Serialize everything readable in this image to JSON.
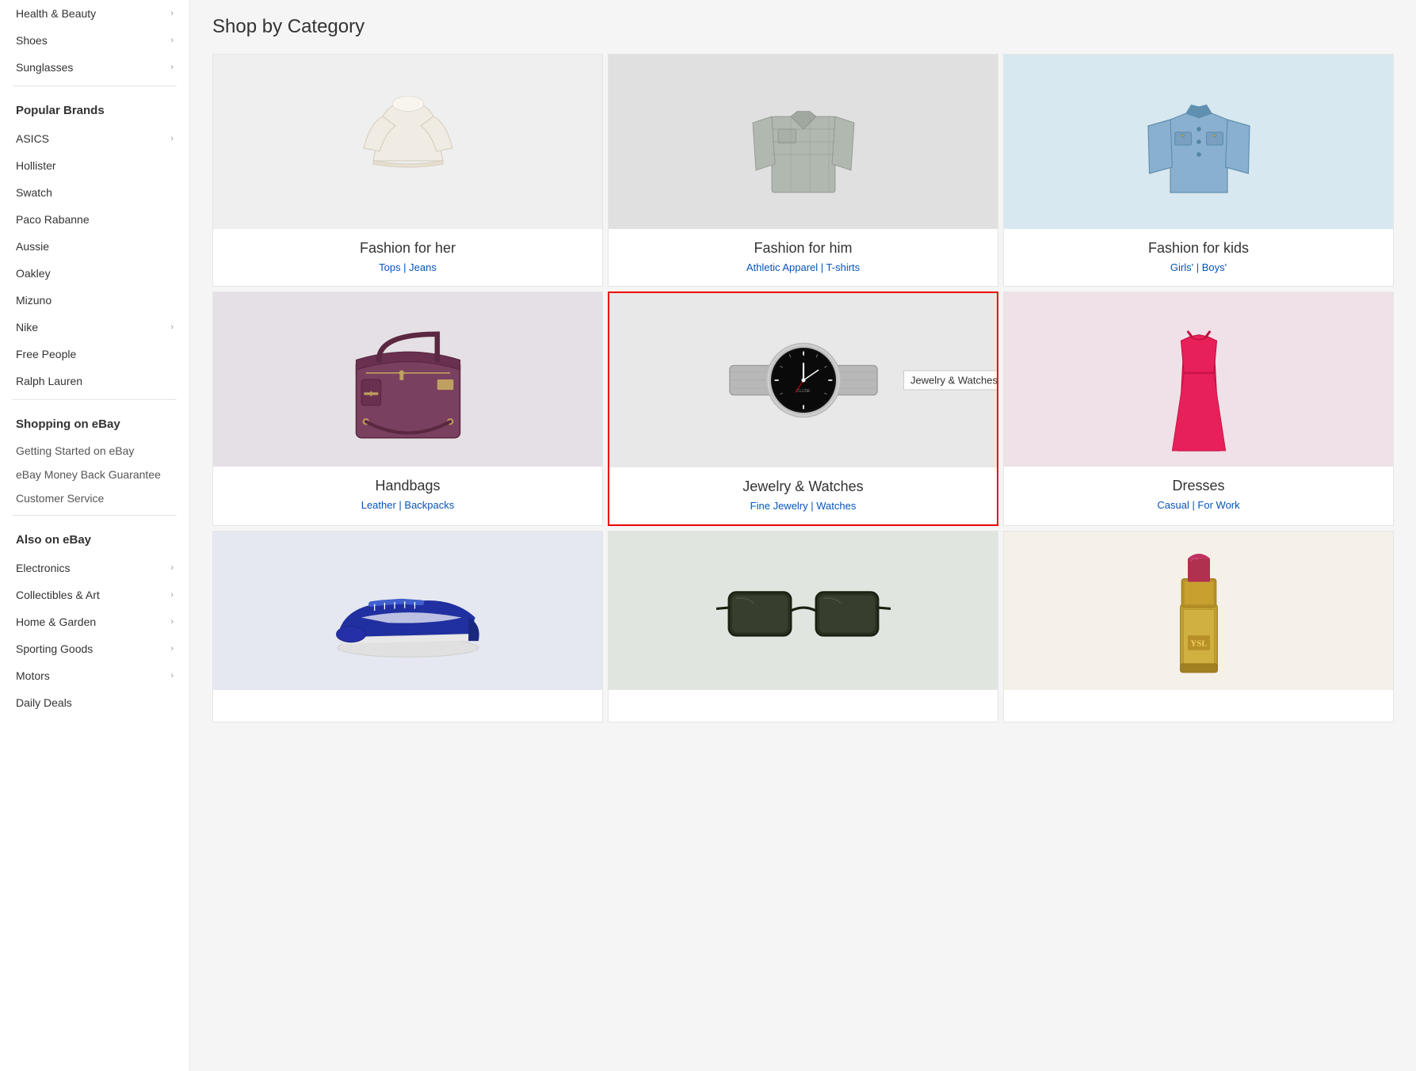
{
  "sidebar": {
    "top_items": [
      {
        "label": "Health & Beauty",
        "has_chevron": true,
        "name": "health-beauty"
      },
      {
        "label": "Shoes",
        "has_chevron": true,
        "name": "shoes"
      },
      {
        "label": "Sunglasses",
        "has_chevron": true,
        "name": "sunglasses"
      }
    ],
    "popular_brands_title": "Popular Brands",
    "brands": [
      {
        "label": "ASICS",
        "has_chevron": true,
        "name": "asics"
      },
      {
        "label": "Hollister",
        "has_chevron": false,
        "name": "hollister"
      },
      {
        "label": "Swatch",
        "has_chevron": false,
        "name": "swatch"
      },
      {
        "label": "Paco Rabanne",
        "has_chevron": false,
        "name": "paco-rabanne"
      },
      {
        "label": "Aussie",
        "has_chevron": false,
        "name": "aussie"
      },
      {
        "label": "Oakley",
        "has_chevron": false,
        "name": "oakley"
      },
      {
        "label": "Mizuno",
        "has_chevron": false,
        "name": "mizuno"
      },
      {
        "label": "Nike",
        "has_chevron": true,
        "name": "nike"
      },
      {
        "label": "Free People",
        "has_chevron": false,
        "name": "free-people"
      },
      {
        "label": "Ralph Lauren",
        "has_chevron": false,
        "name": "ralph-lauren"
      }
    ],
    "shopping_title": "Shopping on eBay",
    "shopping_links": [
      {
        "label": "Getting Started on eBay",
        "name": "getting-started"
      },
      {
        "label": "eBay Money Back Guarantee",
        "name": "money-back"
      },
      {
        "label": "Customer Service",
        "name": "customer-service"
      }
    ],
    "also_title": "Also on eBay",
    "also_items": [
      {
        "label": "Electronics",
        "has_chevron": true,
        "name": "electronics"
      },
      {
        "label": "Collectibles & Art",
        "has_chevron": true,
        "name": "collectibles"
      },
      {
        "label": "Home & Garden",
        "has_chevron": true,
        "name": "home-garden"
      },
      {
        "label": "Sporting Goods",
        "has_chevron": true,
        "name": "sporting-goods"
      },
      {
        "label": "Motors",
        "has_chevron": true,
        "name": "motors"
      },
      {
        "label": "Daily Deals",
        "has_chevron": false,
        "name": "daily-deals"
      }
    ]
  },
  "main": {
    "title": "Shop by Category",
    "categories": [
      {
        "name": "fashion-her",
        "title": "Fashion for her",
        "subtitle": "Tops | Jeans",
        "highlighted": false,
        "tooltip": null
      },
      {
        "name": "fashion-him",
        "title": "Fashion for him",
        "subtitle": "Athletic Apparel | T-shirts",
        "highlighted": false,
        "tooltip": null
      },
      {
        "name": "fashion-kids",
        "title": "Fashion for kids",
        "subtitle": "Girls' | Boys'",
        "highlighted": false,
        "tooltip": null
      },
      {
        "name": "handbags",
        "title": "Handbags",
        "subtitle": "Leather | Backpacks",
        "highlighted": false,
        "tooltip": null
      },
      {
        "name": "jewelry-watches",
        "title": "Jewelry & Watches",
        "subtitle": "Fine Jewelry | Watches",
        "highlighted": true,
        "tooltip": "Jewelry & Watches"
      },
      {
        "name": "dresses",
        "title": "Dresses",
        "subtitle": "Casual | For Work",
        "highlighted": false,
        "tooltip": null
      },
      {
        "name": "shoes-bottom",
        "title": "",
        "subtitle": "",
        "highlighted": false,
        "tooltip": null
      },
      {
        "name": "sunglasses-bottom",
        "title": "",
        "subtitle": "",
        "highlighted": false,
        "tooltip": null
      },
      {
        "name": "beauty-bottom",
        "title": "",
        "subtitle": "",
        "highlighted": false,
        "tooltip": null
      }
    ]
  }
}
